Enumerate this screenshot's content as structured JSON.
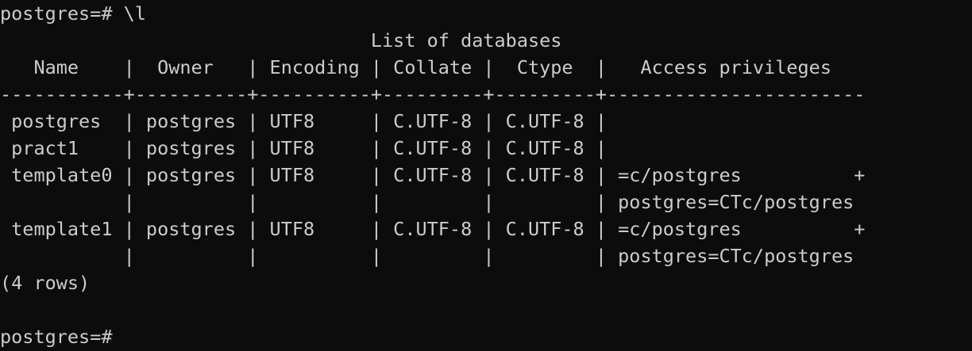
{
  "session": {
    "prompt": "postgres=#",
    "command": "\\l"
  },
  "output": {
    "title_line": "                                 List of databases",
    "header_line": "   Name    |  Owner   | Encoding | Collate |  Ctype  |   Access privileges",
    "separator_line": "-----------+----------+----------+---------+---------+-----------------------",
    "rows": [
      " postgres  | postgres | UTF8     | C.UTF-8 | C.UTF-8 |",
      " pract1    | postgres | UTF8     | C.UTF-8 | C.UTF-8 |",
      " template0 | postgres | UTF8     | C.UTF-8 | C.UTF-8 | =c/postgres          +",
      "           |          |          |         |         | postgres=CTc/postgres",
      " template1 | postgres | UTF8     | C.UTF-8 | C.UTF-8 | =c/postgres          +",
      "           |          |          |         |         | postgres=CTc/postgres"
    ],
    "footer": "(4 rows)"
  },
  "final_prompt": "postgres=#",
  "colors": {
    "background": "#0c0c0c",
    "foreground": "#cccccc"
  }
}
